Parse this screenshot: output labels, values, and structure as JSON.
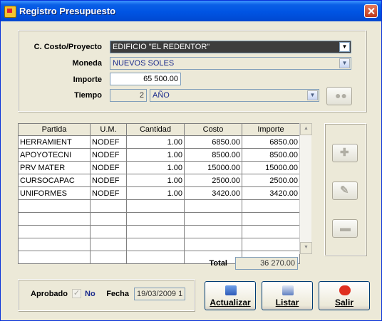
{
  "window": {
    "title": "Registro Presupuesto"
  },
  "form": {
    "cost_center_label": "C. Costo/Proyecto",
    "cost_center_value": "EDIFICIO \"EL REDENTOR\"",
    "currency_label": "Moneda",
    "currency_value": "NUEVOS SOLES",
    "amount_label": "Importe",
    "amount_value": "65 500.00",
    "time_label": "Tiempo",
    "time_value": "2",
    "time_unit_value": "AÑO"
  },
  "table": {
    "columns": [
      "Partida",
      "U.M.",
      "Cantidad",
      "Costo",
      "Importe"
    ],
    "rows": [
      [
        "HERRAMIENT",
        "NODEF",
        "1.00",
        "6850.00",
        "6850.00"
      ],
      [
        "APOYOTECNI",
        "NODEF",
        "1.00",
        "8500.00",
        "8500.00"
      ],
      [
        "PRV MATER",
        "NODEF",
        "1.00",
        "15000.00",
        "15000.00"
      ],
      [
        "CURSOCAPAC",
        "NODEF",
        "1.00",
        "2500.00",
        "2500.00"
      ],
      [
        "UNIFORMES",
        "NODEF",
        "1.00",
        "3420.00",
        "3420.00"
      ]
    ],
    "total_label": "Total",
    "total_value": "36 270.00"
  },
  "footer": {
    "approved_label": "Aprobado",
    "approved_value": "No",
    "date_label": "Fecha",
    "date_value": "19/03/2009 1"
  },
  "buttons": {
    "update": "Actualizar",
    "list": "Listar",
    "exit": "Salir"
  },
  "colors": {
    "title_bar": "#0054e3",
    "selected_field": "#3d3d3d",
    "exit_icon": "#e03020"
  }
}
